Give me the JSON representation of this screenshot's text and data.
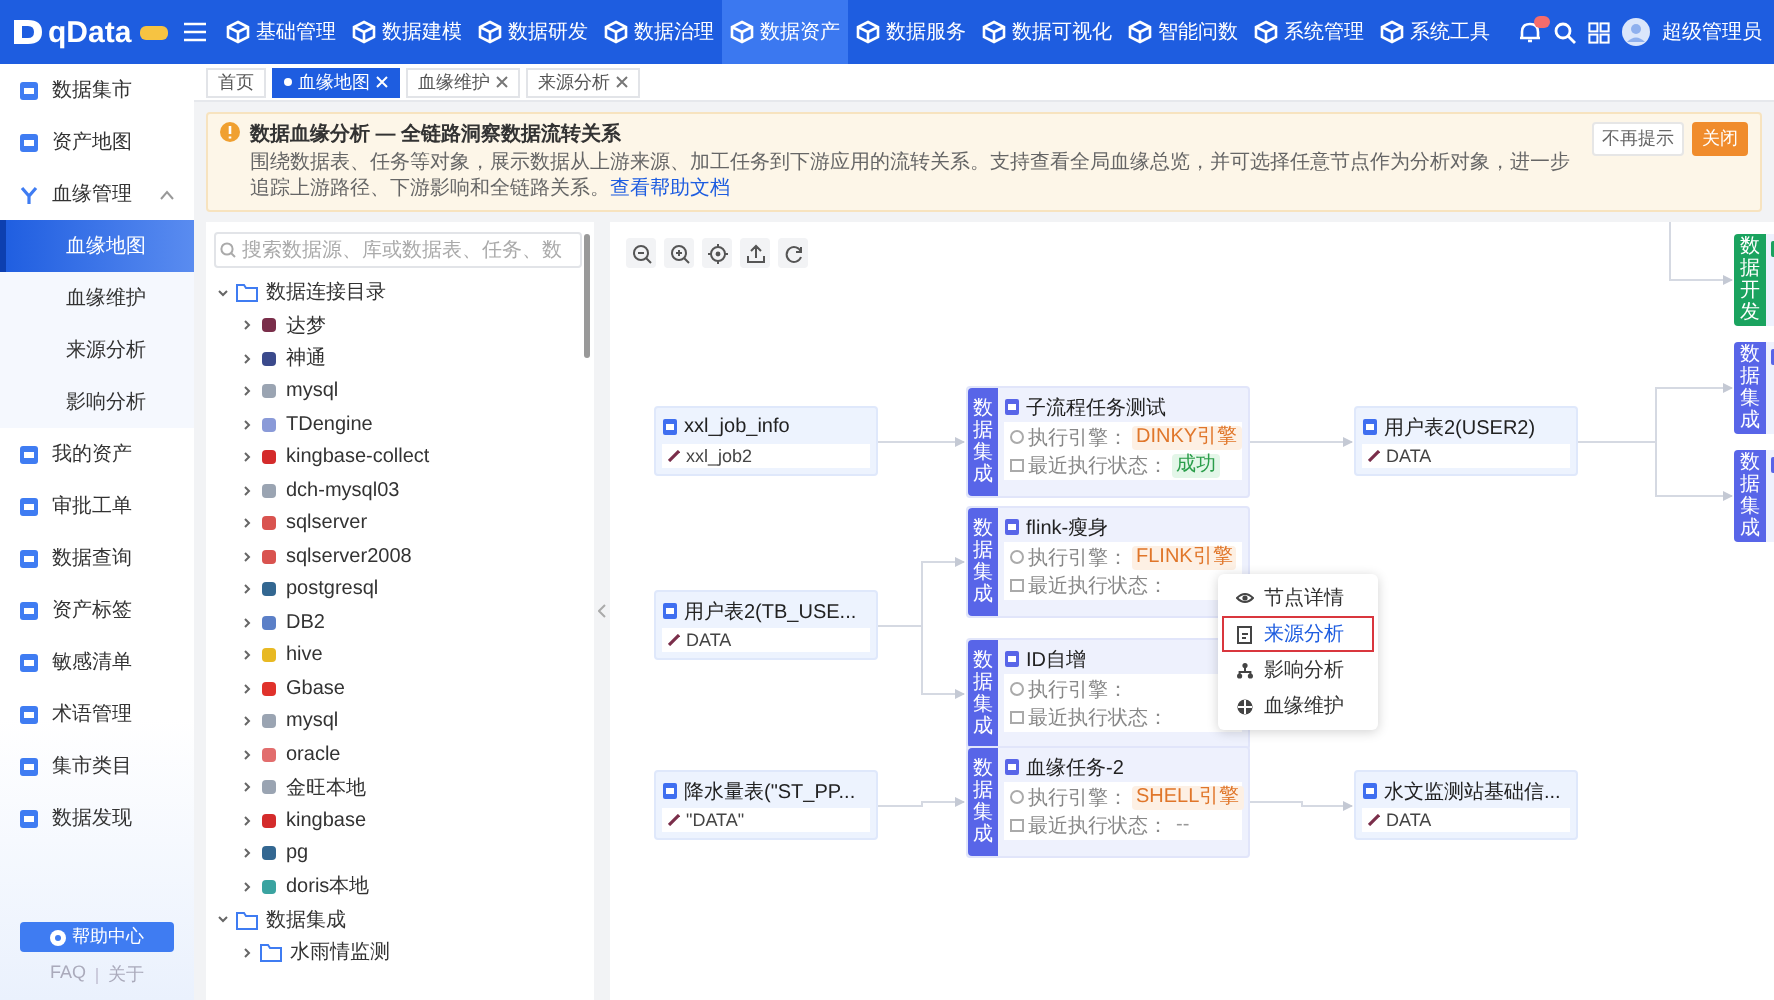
{
  "app": {
    "logo_text": "qData",
    "user": "超级管理员"
  },
  "nav": [
    {
      "label": "基础管理",
      "selected": false
    },
    {
      "label": "数据建模",
      "selected": false
    },
    {
      "label": "数据研发",
      "selected": false
    },
    {
      "label": "数据治理",
      "selected": false
    },
    {
      "label": "数据资产",
      "selected": true
    },
    {
      "label": "数据服务",
      "selected": false
    },
    {
      "label": "数据可视化",
      "selected": false
    },
    {
      "label": "智能问数",
      "selected": false
    },
    {
      "label": "系统管理",
      "selected": false
    },
    {
      "label": "系统工具",
      "selected": false
    }
  ],
  "sidebar": {
    "items": [
      {
        "label": "数据集市",
        "selected": false
      },
      {
        "label": "资产地图",
        "selected": false
      },
      {
        "label": "血缘管理",
        "selected": false,
        "expanded": true,
        "children": [
          {
            "label": "血缘地图",
            "selected": true
          },
          {
            "label": "血缘维护",
            "selected": false
          },
          {
            "label": "来源分析",
            "selected": false
          },
          {
            "label": "影响分析",
            "selected": false
          }
        ]
      },
      {
        "label": "我的资产",
        "selected": false
      },
      {
        "label": "审批工单",
        "selected": false
      },
      {
        "label": "数据查询",
        "selected": false
      },
      {
        "label": "资产标签",
        "selected": false
      },
      {
        "label": "敏感清单",
        "selected": false
      },
      {
        "label": "术语管理",
        "selected": false
      },
      {
        "label": "集市类目",
        "selected": false
      },
      {
        "label": "数据发现",
        "selected": false
      }
    ],
    "help_button": "帮助中心",
    "footer_links": [
      "FAQ",
      "关于"
    ]
  },
  "tabs": [
    {
      "label": "首页",
      "selected": false,
      "closable": false
    },
    {
      "label": "血缘地图",
      "selected": true,
      "closable": true
    },
    {
      "label": "血缘维护",
      "selected": false,
      "closable": true
    },
    {
      "label": "来源分析",
      "selected": false,
      "closable": true
    }
  ],
  "notice": {
    "title": "数据血缘分析 — 全链路洞察数据流转关系",
    "text": "围绕数据表、任务等对象，展示数据从上游来源、加工任务到下游应用的流转关系。支持查看全局血缘总览，并可选择任意节点作为分析对象，进一步追踪上游路径、下游影响和全链路关系。",
    "link": "查看帮助文档",
    "buttons": [
      "不再提示",
      "关闭"
    ]
  },
  "tree": {
    "search": {
      "placeholder": "搜索数据源、库或数据表、任务、数"
    },
    "nodes": [
      {
        "label": "数据连接目录",
        "expanded": true,
        "children": [
          {
            "label": "达梦",
            "expanded": false,
            "color": "#7a2e4a"
          },
          {
            "label": "神通",
            "expanded": false,
            "color": "#3b4a8c"
          },
          {
            "label": "mysql",
            "expanded": false,
            "color": "#9aa4b2"
          },
          {
            "label": "TDengine",
            "expanded": false,
            "color": "#8a9ad8"
          },
          {
            "label": "kingbase-collect",
            "expanded": false,
            "color": "#d42b2b"
          },
          {
            "label": "dch-mysql03",
            "expanded": false,
            "color": "#9aa4b2"
          },
          {
            "label": "sqlserver",
            "expanded": false,
            "color": "#d9534f"
          },
          {
            "label": "sqlserver2008",
            "expanded": false,
            "color": "#d9534f"
          },
          {
            "label": "postgresql",
            "expanded": false,
            "color": "#336791"
          },
          {
            "label": "DB2",
            "expanded": false,
            "color": "#5b7fc7"
          },
          {
            "label": "hive",
            "expanded": false,
            "color": "#e8b923"
          },
          {
            "label": "Gbase",
            "expanded": false,
            "color": "#e0322b"
          },
          {
            "label": "mysql",
            "expanded": false,
            "color": "#9aa4b2"
          },
          {
            "label": "oracle",
            "expanded": false,
            "color": "#e26d6d"
          },
          {
            "label": "金旺本地",
            "expanded": false,
            "color": "#9aa4b2"
          },
          {
            "label": "kingbase",
            "expanded": false,
            "color": "#d42b2b"
          },
          {
            "label": "pg",
            "expanded": false,
            "color": "#336791"
          },
          {
            "label": "doris本地",
            "expanded": false,
            "color": "#3aa3a0"
          }
        ]
      },
      {
        "label": "数据集成",
        "expanded": true,
        "children": [
          {
            "label": "水雨情监测",
            "expanded": false
          }
        ]
      }
    ]
  },
  "lineage": {
    "sources": [
      {
        "title": "xxl_job_info",
        "detail": "xxl_job2"
      },
      {
        "title": "用户表2(TB_USE...",
        "detail": "DATA"
      },
      {
        "title": "降水量表(\"ST_PP...",
        "detail": "\"DATA\""
      }
    ],
    "tasks": [
      {
        "kind": "integration",
        "stripe": "数据集成",
        "title": "子流程任务测试",
        "engine_label": "执行引擎：",
        "engine": "DINKY引擎",
        "status_label": "最近执行状态：",
        "status": "成功"
      },
      {
        "kind": "integration",
        "stripe": "数据集成",
        "title": "flink-瘦身",
        "engine_label": "执行引擎：",
        "engine": "FLINK引擎",
        "status_label": "最近执行状态："
      },
      {
        "kind": "integration",
        "stripe": "数据集成",
        "title": "ID自增",
        "engine_label": "执行引擎：",
        "status_label": "最近执行状态："
      },
      {
        "kind": "integration",
        "stripe": "数据集成",
        "title": "血缘任务-2",
        "engine_label": "执行引擎：",
        "engine": "SHELL引擎",
        "status_label": "最近执行状态：",
        "status": "--"
      }
    ],
    "targets": [
      {
        "title": "用户表2(USER2)",
        "detail": "DATA"
      },
      {
        "title": "水文监测站基础信...",
        "detail": "DATA"
      }
    ],
    "offscreen_tasks": [
      {
        "kind": "development",
        "stripe": "数据开发"
      },
      {
        "kind": "integration",
        "stripe": "数据集成"
      },
      {
        "kind": "integration",
        "stripe": "数据集成"
      }
    ],
    "context_menu": [
      {
        "label": "节点详情",
        "selected": false
      },
      {
        "label": "来源分析",
        "selected": true
      },
      {
        "label": "影响分析",
        "selected": false
      },
      {
        "label": "血缘维护",
        "selected": false
      }
    ]
  }
}
